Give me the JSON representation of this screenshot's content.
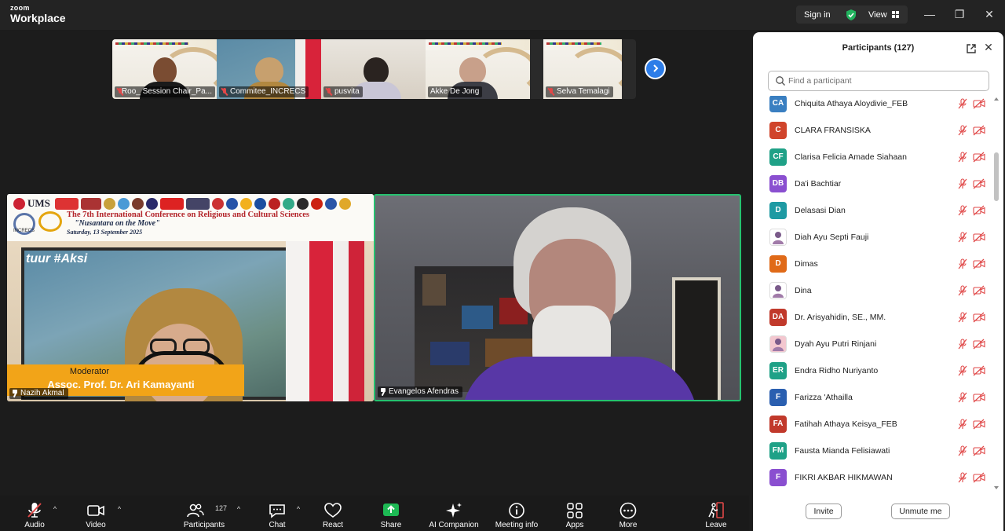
{
  "app": {
    "logo_line1": "zoom",
    "logo_line2": "Workplace",
    "signin": "Sign in",
    "view": "View",
    "minimize": "—",
    "maximize": "❐",
    "close": "✕"
  },
  "thumbnails": [
    {
      "name": "Roo_ Session Chair_Pa...",
      "muted": true
    },
    {
      "name": "Commitee_INCRECS",
      "muted": true
    },
    {
      "name": "pusvita",
      "muted": true
    },
    {
      "name": "Akke De Jong",
      "muted": false
    },
    {
      "name": "Selva Temalagi",
      "muted": true
    }
  ],
  "videos": {
    "left": {
      "name": "Nazih Akmal",
      "ums": "UMS",
      "conf_title": "The 7th International Conference on Religious and Cultural Sciences",
      "conf_subtitle": "\"Nusantara on the Move\"",
      "conf_date": "Saturday, 13 September 2025",
      "incrs": "INCRECS",
      "map_text": "tuur #Aksi",
      "moderator_title": "Moderator",
      "moderator_name": "Assoc. Prof. Dr. Ari Kamayanti"
    },
    "right": {
      "name": "Evangelos Afendras"
    }
  },
  "panel": {
    "title": "Participants (127)",
    "search_placeholder": "Find a participant",
    "participants": [
      {
        "initials": "CA",
        "name": "Chiquita Athaya Aloydivie_FEB",
        "color": "#3a7fc1"
      },
      {
        "initials": "C",
        "name": "CLARA FRANSISKA",
        "color": "#d0442b"
      },
      {
        "initials": "CF",
        "name": "Clarisa Felicia Amade Siahaan",
        "color": "#1fa187"
      },
      {
        "initials": "DB",
        "name": "Da'i Bachtiar",
        "color": "#8a4fd0"
      },
      {
        "initials": "D",
        "name": "Delasasi Dian",
        "color": "#1e9aa3"
      },
      {
        "initials": "",
        "name": "Diah Ayu Septi Fauji",
        "color": "#ffffff"
      },
      {
        "initials": "D",
        "name": "Dimas",
        "color": "#e06a18"
      },
      {
        "initials": "",
        "name": "Dina",
        "color": "#ffffff"
      },
      {
        "initials": "DA",
        "name": "Dr. Arisyahidin, SE., MM.",
        "color": "#c1392b"
      },
      {
        "initials": "",
        "name": "Dyah Ayu Putri Rinjani",
        "color": "#f3c7cf"
      },
      {
        "initials": "ER",
        "name": "Endra Ridho Nuriyanto",
        "color": "#1fa187"
      },
      {
        "initials": "F",
        "name": "Farizza 'Athailla",
        "color": "#2a5fb0"
      },
      {
        "initials": "FA",
        "name": "Fatihah Athaya Keisya_FEB",
        "color": "#c1392b"
      },
      {
        "initials": "FM",
        "name": "Fausta Mianda Felisiawati",
        "color": "#1fa187"
      },
      {
        "initials": "F",
        "name": "FIKRI AKBAR HIKMAWAN",
        "color": "#8a4fd0"
      }
    ],
    "invite": "Invite",
    "unmute_me": "Unmute me"
  },
  "toolbar": {
    "audio": "Audio",
    "video": "Video",
    "participants": "Participants",
    "participants_count": "127",
    "chat": "Chat",
    "react": "React",
    "share": "Share",
    "ai_companion": "AI Companion",
    "meeting_info": "Meeting info",
    "apps": "Apps",
    "more": "More",
    "leave": "Leave"
  },
  "colors": {
    "active_speaker": "#25c16f",
    "share_green": "#1db954",
    "muted_red": "#e04848",
    "accent_blue": "#2d7de8"
  }
}
